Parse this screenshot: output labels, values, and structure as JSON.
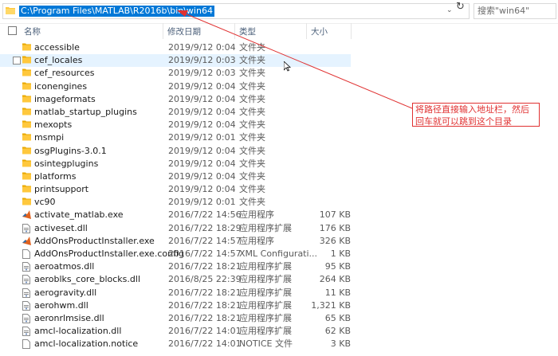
{
  "address": {
    "path": "C:\\Program Files\\MATLAB\\R2016b\\bin\\win64",
    "search_placeholder": "搜索\"win64\""
  },
  "columns": {
    "name": "名称",
    "date": "修改日期",
    "type": "类型",
    "size": "大小"
  },
  "files": [
    {
      "name": "accessible",
      "date": "2019/9/12 0:04",
      "type": "文件夹",
      "size": "",
      "icon": "folder-icon"
    },
    {
      "name": "cef_locales",
      "date": "2019/9/12 0:03",
      "type": "文件夹",
      "size": "",
      "icon": "folder-icon",
      "hover": true
    },
    {
      "name": "cef_resources",
      "date": "2019/9/12 0:03",
      "type": "文件夹",
      "size": "",
      "icon": "folder-icon"
    },
    {
      "name": "iconengines",
      "date": "2019/9/12 0:04",
      "type": "文件夹",
      "size": "",
      "icon": "folder-icon"
    },
    {
      "name": "imageformats",
      "date": "2019/9/12 0:04",
      "type": "文件夹",
      "size": "",
      "icon": "folder-icon"
    },
    {
      "name": "matlab_startup_plugins",
      "date": "2019/9/12 0:04",
      "type": "文件夹",
      "size": "",
      "icon": "folder-icon"
    },
    {
      "name": "mexopts",
      "date": "2019/9/12 0:04",
      "type": "文件夹",
      "size": "",
      "icon": "folder-icon"
    },
    {
      "name": "msmpi",
      "date": "2019/9/12 0:01",
      "type": "文件夹",
      "size": "",
      "icon": "folder-icon"
    },
    {
      "name": "osgPlugins-3.0.1",
      "date": "2019/9/12 0:04",
      "type": "文件夹",
      "size": "",
      "icon": "folder-icon"
    },
    {
      "name": "osintegplugins",
      "date": "2019/9/12 0:04",
      "type": "文件夹",
      "size": "",
      "icon": "folder-icon"
    },
    {
      "name": "platforms",
      "date": "2019/9/12 0:04",
      "type": "文件夹",
      "size": "",
      "icon": "folder-icon"
    },
    {
      "name": "printsupport",
      "date": "2019/9/12 0:04",
      "type": "文件夹",
      "size": "",
      "icon": "folder-icon"
    },
    {
      "name": "vc90",
      "date": "2019/9/12 0:01",
      "type": "文件夹",
      "size": "",
      "icon": "folder-icon"
    },
    {
      "name": "activate_matlab.exe",
      "date": "2016/7/22 14:56",
      "type": "应用程序",
      "size": "107 KB",
      "icon": "matlab-exe-icon"
    },
    {
      "name": "activeset.dll",
      "date": "2016/7/22 18:29",
      "type": "应用程序扩展",
      "size": "176 KB",
      "icon": "dll-file-icon"
    },
    {
      "name": "AddOnsProductInstaller.exe",
      "date": "2016/7/22 14:57",
      "type": "应用程序",
      "size": "326 KB",
      "icon": "matlab-exe-icon"
    },
    {
      "name": "AddOnsProductInstaller.exe.config",
      "date": "2016/7/22 14:57",
      "type": "XML Configurati...",
      "size": "1 KB",
      "icon": "config-file-icon"
    },
    {
      "name": "aeroatmos.dll",
      "date": "2016/7/22 18:21",
      "type": "应用程序扩展",
      "size": "95 KB",
      "icon": "dll-file-icon"
    },
    {
      "name": "aeroblks_core_blocks.dll",
      "date": "2016/8/25 22:39",
      "type": "应用程序扩展",
      "size": "264 KB",
      "icon": "dll-file-icon"
    },
    {
      "name": "aerogravity.dll",
      "date": "2016/7/22 18:21",
      "type": "应用程序扩展",
      "size": "11 KB",
      "icon": "dll-file-icon"
    },
    {
      "name": "aerohwm.dll",
      "date": "2016/7/22 18:21",
      "type": "应用程序扩展",
      "size": "1,321 KB",
      "icon": "dll-file-icon"
    },
    {
      "name": "aeronrlmsise.dll",
      "date": "2016/7/22 18:21",
      "type": "应用程序扩展",
      "size": "65 KB",
      "icon": "dll-file-icon"
    },
    {
      "name": "amcl-localization.dll",
      "date": "2016/7/22 14:01",
      "type": "应用程序扩展",
      "size": "62 KB",
      "icon": "dll-file-icon"
    },
    {
      "name": "amcl-localization.notice",
      "date": "2016/7/22 14:01",
      "type": "NOTICE 文件",
      "size": "3 KB",
      "icon": "blank-file-icon"
    }
  ],
  "annotation": {
    "text": "将路径直接输入地址栏，然后回车就可以跳到这个目录"
  },
  "colors": {
    "selection": "#0078d7",
    "hover_row": "#e5f3ff",
    "annotation_red": "#e03131",
    "folder": "#ffc83d"
  }
}
